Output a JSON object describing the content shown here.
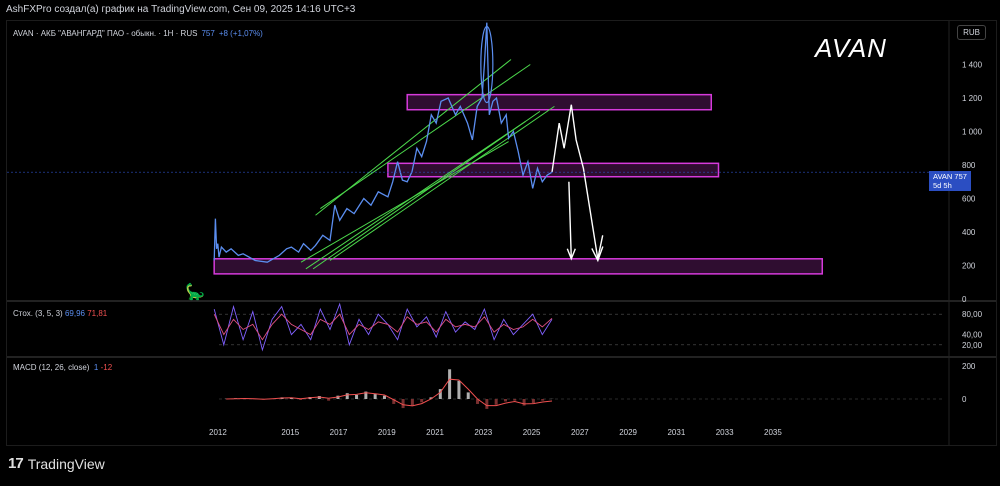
{
  "header": {
    "title": "AshFXPro создал(а) график на TradingView.com, Сен 09, 2025 14:16 UTC+3"
  },
  "legend": {
    "symbol_line": "AVAN · АКБ \"АВАНГАРД\" ПАО - обыкн. · 1Н · RUS",
    "price": "757",
    "change": "+8 (+1,07%)"
  },
  "currency": "RUB",
  "watermark": "AVAN",
  "price_tag": {
    "symbol": "AVAN",
    "price": "757",
    "countdown": "5d 5h"
  },
  "stoch": {
    "label": "Стох. (3, 5, 3)",
    "k": "69,96",
    "d": "71,81"
  },
  "macd": {
    "label": "MACD (12, 26, close)",
    "hist": "1",
    "signal": "-12"
  },
  "footer": {
    "logo": "17",
    "brand": "TradingView"
  },
  "colors": {
    "price": "#5b8ef0",
    "channel": "#4cd94c",
    "zone": "#d63adb",
    "projection": "#ffffff",
    "stoch_k": "#8060ff",
    "stoch_d": "#e05080",
    "macd_hist_pos": "#b0b0b0",
    "macd_line": "#f05050"
  },
  "chart_data": [
    {
      "type": "line",
      "title": "AVAN · АКБ \"АВАНГАРД\" ПАО - обыкн. · 1Н · RUS",
      "ylim": [
        0,
        1600
      ],
      "yticks": [
        0,
        200,
        400,
        600,
        800,
        1000,
        1200,
        1400,
        1600
      ],
      "ytick_labels": [
        "0",
        "200",
        "400",
        "600",
        "800",
        "1 000",
        "1 200",
        "1 400",
        "1 600"
      ],
      "xlim": [
        2012.0,
        2037.0
      ],
      "xticks": [
        2012,
        2015,
        2017,
        2019,
        2021,
        2023,
        2025,
        2027,
        2029,
        2031,
        2033,
        2035
      ],
      "series": [
        {
          "x": [
            2011.8,
            2011.85,
            2011.9,
            2011.95,
            2012.0,
            2012.1,
            2012.3,
            2012.5,
            2012.8,
            2013.0,
            2013.5,
            2014.0,
            2014.5,
            2014.8,
            2015.0,
            2015.3,
            2015.5,
            2015.8,
            2016.0,
            2016.3,
            2016.6,
            2016.8,
            2017.0,
            2017.3,
            2017.6,
            2018.0,
            2018.3,
            2018.6,
            2019.0,
            2019.2,
            2019.4,
            2019.6,
            2019.8,
            2020.0,
            2020.2,
            2020.4,
            2020.6,
            2020.8,
            2021.0,
            2021.2,
            2021.5,
            2021.8,
            2022.0,
            2022.3,
            2022.5,
            2022.7,
            2022.9,
            2023.0,
            2023.1,
            2023.2,
            2023.35,
            2023.5,
            2023.7,
            2023.9,
            2024.0,
            2024.2,
            2024.4,
            2024.6,
            2024.8,
            2025.0,
            2025.2,
            2025.4,
            2025.6,
            2025.8
          ],
          "values": [
            230,
            480,
            300,
            330,
            250,
            310,
            280,
            300,
            260,
            270,
            230,
            220,
            260,
            300,
            310,
            280,
            330,
            290,
            320,
            380,
            350,
            560,
            470,
            540,
            510,
            600,
            560,
            640,
            610,
            700,
            820,
            710,
            700,
            760,
            900,
            850,
            940,
            1100,
            1050,
            1180,
            1200,
            1100,
            1150,
            1050,
            950,
            1150,
            1200,
            1400,
            1650,
            1100,
            1180,
            1200,
            1050,
            1100,
            960,
            1000,
            880,
            740,
            820,
            660,
            780,
            700,
            740,
            757
          ]
        }
      ],
      "annotations": {
        "zones": [
          {
            "from": 1130,
            "to": 1220,
            "x": [
              2019.8,
              2032.4
            ]
          },
          {
            "from": 730,
            "to": 810,
            "x": [
              2019.0,
              2032.7
            ]
          },
          {
            "from": 150,
            "to": 240,
            "x": [
              2011.8,
              2037.0
            ]
          }
        ],
        "channel_lines": [
          {
            "from": [
              2015.9,
              180
            ],
            "to": [
              2025.3,
              1120
            ]
          },
          {
            "from": [
              2016.6,
              230
            ],
            "to": [
              2025.9,
              1150
            ]
          },
          {
            "from": [
              2016.0,
              500
            ],
            "to": [
              2024.1,
              1430
            ]
          },
          {
            "from": [
              2016.2,
              540
            ],
            "to": [
              2024.9,
              1400
            ]
          },
          {
            "from": [
              2015.6,
              180
            ],
            "to": [
              2024.7,
              1060
            ]
          },
          {
            "from": [
              2015.4,
              220
            ],
            "to": [
              2024.0,
              940
            ]
          }
        ],
        "projection": {
          "x": [
            2025.8,
            2026.1,
            2026.3,
            2026.6,
            2026.8,
            2027.1,
            2027.3,
            2027.7,
            2027.9
          ],
          "values": [
            757,
            1050,
            900,
            1160,
            950,
            780,
            600,
            240,
            380
          ]
        },
        "peak_ellipse": {
          "x": 2023.1,
          "y": 1400
        }
      }
    },
    {
      "type": "line",
      "title": "Стох. (3, 5, 3)",
      "ylim": [
        0,
        100
      ],
      "yticks": [
        20,
        40,
        80
      ],
      "ytick_labels": [
        "20,00",
        "40,00",
        "80,00"
      ],
      "series": [
        {
          "name": "K",
          "values": [
            90,
            20,
            95,
            30,
            85,
            10,
            70,
            95,
            40,
            60,
            30,
            90,
            50,
            100,
            20,
            70,
            40,
            80,
            60,
            30,
            90,
            55,
            75,
            35,
            85,
            45,
            65,
            50,
            90,
            30,
            70,
            40,
            60,
            80,
            40,
            70
          ]
        },
        {
          "name": "D",
          "values": [
            80,
            40,
            70,
            50,
            60,
            30,
            60,
            80,
            60,
            50,
            40,
            70,
            60,
            80,
            40,
            60,
            50,
            65,
            60,
            45,
            75,
            60,
            65,
            45,
            70,
            55,
            60,
            55,
            75,
            45,
            60,
            50,
            55,
            70,
            55,
            72
          ]
        }
      ]
    },
    {
      "type": "bar",
      "title": "MACD (12, 26, close)",
      "yticks": [
        0,
        200
      ],
      "ytick_labels": [
        "0",
        "200"
      ],
      "series": [
        {
          "name": "histogram",
          "values": [
            2,
            5,
            3,
            -2,
            -4,
            3,
            10,
            8,
            -6,
            12,
            18,
            -10,
            20,
            35,
            25,
            45,
            30,
            20,
            -30,
            -55,
            -40,
            -20,
            10,
            60,
            180,
            110,
            40,
            -30,
            -60,
            -35,
            -15,
            -10,
            -40,
            -25,
            -10,
            1
          ]
        },
        {
          "name": "signal",
          "values": [
            0,
            2,
            3,
            1,
            -1,
            2,
            6,
            7,
            2,
            8,
            12,
            5,
            12,
            25,
            28,
            38,
            32,
            24,
            -5,
            -35,
            -42,
            -28,
            0,
            40,
            120,
            115,
            60,
            0,
            -40,
            -40,
            -25,
            -15,
            -30,
            -28,
            -18,
            -12
          ]
        }
      ]
    }
  ]
}
